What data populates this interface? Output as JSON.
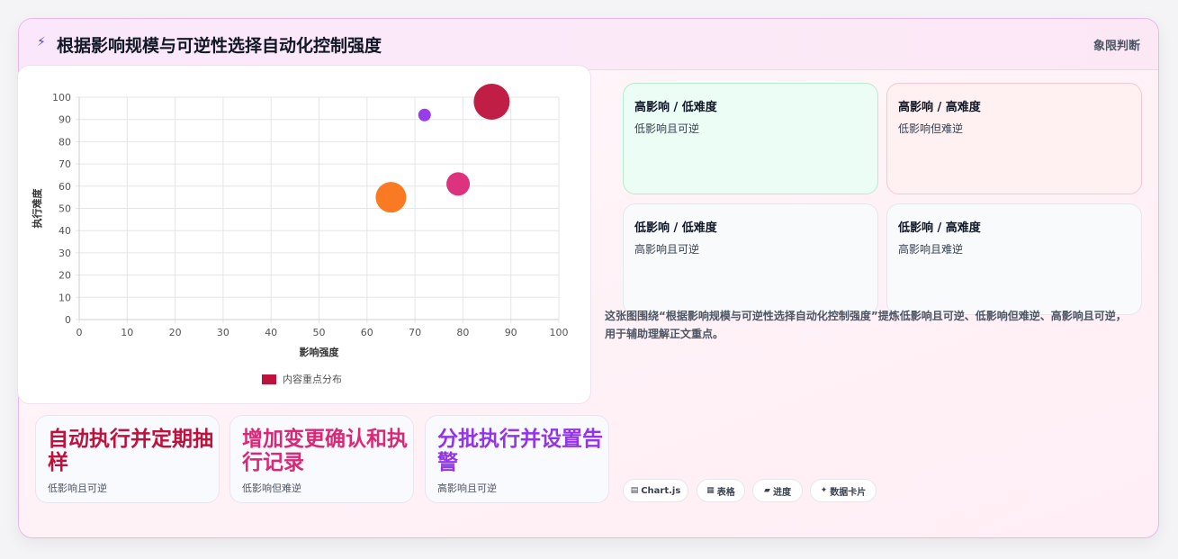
{
  "header": {
    "icon": "lightning-icon",
    "title": "根据影响规模与可逆性选择自动化控制强度",
    "tag": "象限判断"
  },
  "chart_data": {
    "type": "bubble",
    "xlabel": "影响强度",
    "ylabel": "执行难度",
    "xlim": [
      0,
      100
    ],
    "ylim": [
      0,
      100
    ],
    "xticks": [
      0,
      10,
      20,
      30,
      40,
      50,
      60,
      70,
      80,
      90,
      100
    ],
    "yticks": [
      0,
      10,
      20,
      30,
      40,
      50,
      60,
      70,
      80,
      90,
      100
    ],
    "grid": true,
    "legend_position": "bottom",
    "series": [
      {
        "name": "内容重点分布",
        "color": "#be123c",
        "points": [
          {
            "x": 86,
            "y": 98,
            "r": 20,
            "color": "#be123c"
          },
          {
            "x": 72,
            "y": 92,
            "r": 7,
            "color": "#9333ea"
          },
          {
            "x": 79,
            "y": 61,
            "r": 13,
            "color": "#db2777"
          },
          {
            "x": 65,
            "y": 55,
            "r": 17,
            "color": "#f97316"
          }
        ]
      }
    ]
  },
  "metrics": [
    {
      "value": "自动执行并定期抽样",
      "label": "低影响且可逆",
      "color": "#be123c"
    },
    {
      "value": "增加变更确认和执行记录",
      "label": "低影响但难逆",
      "color": "#db2777"
    },
    {
      "value": "分批执行并设置告警",
      "label": "高影响且可逆",
      "color": "#9333ea"
    }
  ],
  "quadrants": [
    {
      "title": "高影响 / 低难度",
      "text": "低影响且可逆",
      "bg": "#ecfdf5",
      "border": "#b7ebcf"
    },
    {
      "title": "高影响 / 高难度",
      "text": "低影响但难逆",
      "bg": "#fff1f2",
      "border": "#f5c6d3"
    },
    {
      "title": "低影响 / 低难度",
      "text": "高影响且可逆",
      "bg": "#f8fafc",
      "border": "#e5e7eb"
    },
    {
      "title": "低影响 / 高难度",
      "text": "高影响且难逆",
      "bg": "#f8fafc",
      "border": "#e5e7eb"
    }
  ],
  "description": "这张图围绕“根据影响规模与可逆性选择自动化控制强度”提炼低影响且可逆、低影响但难逆、高影响且可逆，用于辅助理解正文重点。",
  "pills": [
    {
      "icon": "chart-icon",
      "glyph": "▤",
      "label": "Chart.js"
    },
    {
      "icon": "table-icon",
      "glyph": "▦",
      "label": "表格"
    },
    {
      "icon": "progress-icon",
      "glyph": "▰",
      "label": "进度"
    },
    {
      "icon": "sparkle-icon",
      "glyph": "✦",
      "label": "数据卡片"
    }
  ]
}
